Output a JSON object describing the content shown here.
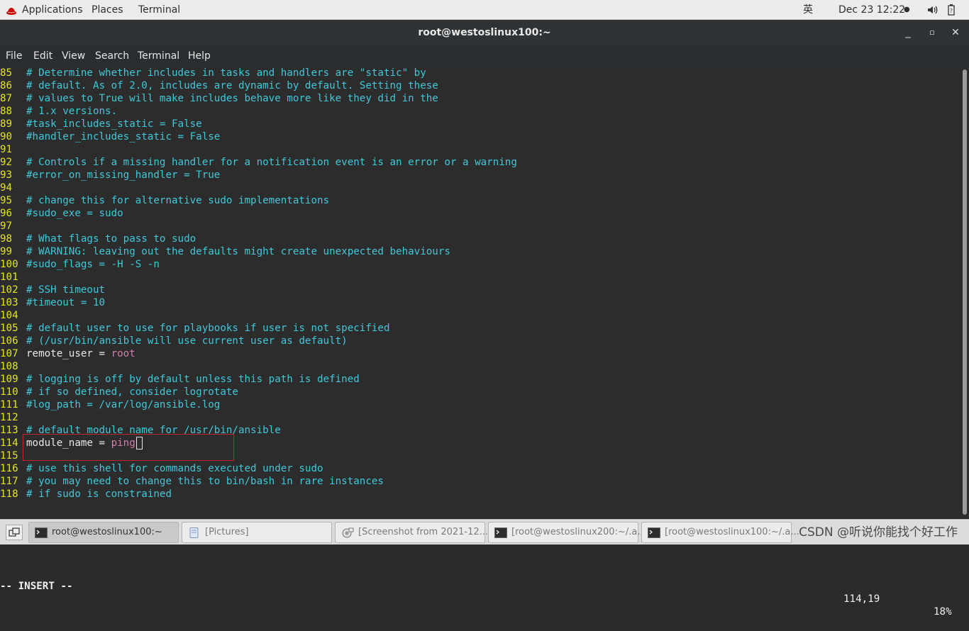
{
  "topbar": {
    "applications": "Applications",
    "places": "Places",
    "terminal": "Terminal",
    "input_method": "英",
    "clock": "Dec 23  12:22",
    "accent": "#cc0000"
  },
  "window": {
    "title": "root@westoslinux100:~",
    "minimize": "_",
    "maximize": "▫",
    "close": "✕"
  },
  "menu": [
    "File",
    "Edit",
    "View",
    "Search",
    "Terminal",
    "Help"
  ],
  "editor": {
    "lines": [
      {
        "n": "85",
        "seg": [
          [
            "cm",
            "# Determine whether includes in tasks and handlers are \"static\" by"
          ]
        ]
      },
      {
        "n": "86",
        "seg": [
          [
            "cm",
            "# default. As of 2.0, includes are dynamic by default. Setting these"
          ]
        ]
      },
      {
        "n": "87",
        "seg": [
          [
            "cm",
            "# values to True will make includes behave more like they did in the"
          ]
        ]
      },
      {
        "n": "88",
        "seg": [
          [
            "cm",
            "# 1.x versions."
          ]
        ]
      },
      {
        "n": "89",
        "seg": [
          [
            "cm",
            "#task_includes_static = False"
          ]
        ]
      },
      {
        "n": "90",
        "seg": [
          [
            "cm",
            "#handler_includes_static = False"
          ]
        ]
      },
      {
        "n": "91",
        "seg": []
      },
      {
        "n": "92",
        "seg": [
          [
            "cm",
            "# Controls if a missing handler for a notification event is an error or a warning"
          ]
        ]
      },
      {
        "n": "93",
        "seg": [
          [
            "cm",
            "#error_on_missing_handler = True"
          ]
        ]
      },
      {
        "n": "94",
        "seg": []
      },
      {
        "n": "95",
        "seg": [
          [
            "cm",
            "# change this for alternative sudo implementations"
          ]
        ]
      },
      {
        "n": "96",
        "seg": [
          [
            "cm",
            "#sudo_exe = sudo"
          ]
        ]
      },
      {
        "n": "97",
        "seg": []
      },
      {
        "n": "98",
        "seg": [
          [
            "cm",
            "# What flags to pass to sudo"
          ]
        ]
      },
      {
        "n": "99",
        "seg": [
          [
            "cm",
            "# WARNING: leaving out the defaults might create unexpected behaviours"
          ]
        ]
      },
      {
        "n": "100",
        "seg": [
          [
            "cm",
            "#sudo_flags = -H -S -n"
          ]
        ]
      },
      {
        "n": "101",
        "seg": []
      },
      {
        "n": "102",
        "seg": [
          [
            "cm",
            "# SSH timeout"
          ]
        ]
      },
      {
        "n": "103",
        "seg": [
          [
            "cm",
            "#timeout = 10"
          ]
        ]
      },
      {
        "n": "104",
        "seg": []
      },
      {
        "n": "105",
        "seg": [
          [
            "cm",
            "# default user to use for playbooks if user is not specified"
          ]
        ]
      },
      {
        "n": "106",
        "seg": [
          [
            "cm",
            "# (/usr/bin/ansible will use current user as default)"
          ]
        ]
      },
      {
        "n": "107",
        "seg": [
          [
            "tx",
            "remote_user = "
          ],
          [
            "vl",
            "root"
          ]
        ]
      },
      {
        "n": "108",
        "seg": []
      },
      {
        "n": "109",
        "seg": [
          [
            "cm",
            "# logging is off by default unless this path is defined"
          ]
        ]
      },
      {
        "n": "110",
        "seg": [
          [
            "cm",
            "# if so defined, consider logrotate"
          ]
        ]
      },
      {
        "n": "111",
        "seg": [
          [
            "cm",
            "#log_path = /var/log/ansible.log"
          ]
        ]
      },
      {
        "n": "112",
        "seg": []
      },
      {
        "n": "113",
        "seg": [
          [
            "cm",
            "# default module name for /usr/bin/ansible"
          ]
        ]
      },
      {
        "n": "114",
        "seg": [
          [
            "tx",
            "module_name = "
          ],
          [
            "vl",
            "ping"
          ],
          [
            "cursor",
            ""
          ]
        ]
      },
      {
        "n": "115",
        "seg": []
      },
      {
        "n": "116",
        "seg": [
          [
            "cm",
            "# use this shell for commands executed under sudo"
          ]
        ]
      },
      {
        "n": "117",
        "seg": [
          [
            "cm",
            "# you may need to change this to bin/bash in rare instances"
          ]
        ]
      },
      {
        "n": "118",
        "seg": [
          [
            "cm",
            "# if sudo is constrained"
          ]
        ]
      }
    ],
    "mode": "-- INSERT --",
    "position": "114,19",
    "percent": "18%"
  },
  "taskbar": {
    "items": [
      {
        "label": "root@westoslinux100:~",
        "icon": "terminal-icon",
        "active": true
      },
      {
        "label": "[Pictures]",
        "icon": "folder-icon",
        "active": false
      },
      {
        "label": "[Screenshot from 2021-12...",
        "icon": "image-viewer-icon",
        "active": false
      },
      {
        "label": "[root@westoslinux200:~/.a...",
        "icon": "terminal-icon",
        "active": false
      },
      {
        "label": "[root@westoslinux100:~/.a...",
        "icon": "terminal-icon",
        "active": false
      }
    ],
    "watermark": "CSDN @听说你能找个好工作"
  }
}
